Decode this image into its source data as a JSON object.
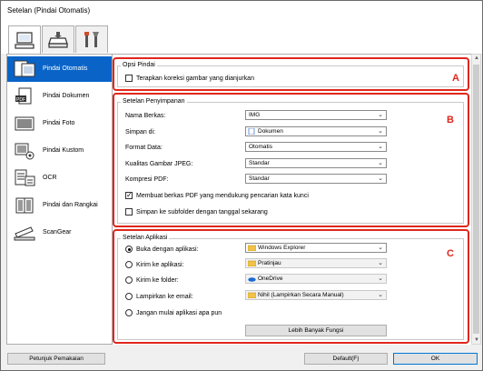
{
  "window": {
    "title": "Setelan (Pindai Otomatis)"
  },
  "tabs": [
    {
      "icon": "scan-from-computer-icon"
    },
    {
      "icon": "scan-from-panel-icon"
    },
    {
      "icon": "general-settings-icon"
    }
  ],
  "sidebar": {
    "items": [
      {
        "label": "Pindai Otomatis",
        "icon": "auto-scan-icon",
        "selected": true
      },
      {
        "label": "Pindai Dokumen",
        "icon": "pdf-document-icon"
      },
      {
        "label": "Pindai Foto",
        "icon": "photo-icon"
      },
      {
        "label": "Pindai Kustom",
        "icon": "custom-scan-icon"
      },
      {
        "label": "OCR",
        "icon": "ocr-icon"
      },
      {
        "label": "Pindai dan Rangkai",
        "icon": "stitch-icon"
      },
      {
        "label": "ScanGear",
        "icon": "scangear-icon"
      }
    ]
  },
  "opsi_pindai": {
    "title": "Opsi Pindai",
    "checkbox_label": "Terapkan koreksi gambar yang dianjurkan",
    "checked": false,
    "marker": "A"
  },
  "setelan_penyimpanan": {
    "title": "Setelan Penyimpanan",
    "marker": "B",
    "nama_berkas": {
      "label": "Nama Berkas:",
      "value": "IMG"
    },
    "simpan_di": {
      "label": "Simpan di:",
      "value": "Dokumen"
    },
    "format_data": {
      "label": "Format Data:",
      "value": "Otomatis"
    },
    "kualitas_jpeg": {
      "label": "Kualitas Gambar JPEG:",
      "value": "Standar"
    },
    "kompresi_pdf": {
      "label": "Kompresi PDF:",
      "value": "Standar"
    },
    "cb_pdf": {
      "label": "Membuat berkas PDF yang mendukung pencarian kata kunci",
      "checked": true
    },
    "cb_subfolder": {
      "label": "Simpan ke subfolder dengan tanggal sekarang",
      "checked": false
    }
  },
  "setelan_aplikasi": {
    "title": "Setelan Aplikasi",
    "marker": "C",
    "buka": {
      "label": "Buka dengan aplikasi:",
      "value": "Windows Explorer",
      "selected": true
    },
    "kirim_app": {
      "label": "Kirim ke aplikasi:",
      "value": "Pratinjau"
    },
    "kirim_folder": {
      "label": "Kirim ke folder:",
      "value": "OneDrive"
    },
    "lampirkan": {
      "label": "Lampirkan ke email:",
      "value": "Nihil (Lampirkan Secara Manual)"
    },
    "jangan": {
      "label": "Jangan mulai aplikasi apa pun"
    },
    "more_button": "Lebih Banyak Fungsi"
  },
  "footer": {
    "help_button": "Petunjuk Pemakaian",
    "defaults_button": "Default(F)",
    "ok_button": "OK"
  },
  "colors": {
    "marker_red": "#e1261c",
    "selection_blue": "#0a64c8"
  }
}
